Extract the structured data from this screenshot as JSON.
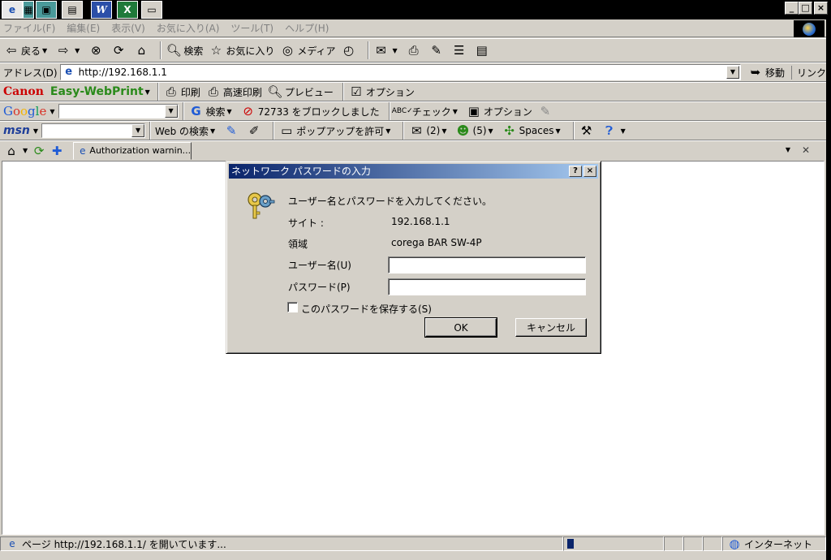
{
  "menu": [
    "ファイル(F)",
    "編集(E)",
    "表示(V)",
    "お気に入り(A)",
    "ツール(T)",
    "ヘルプ(H)"
  ],
  "toolbar": {
    "back": "戻る",
    "search": "検索",
    "favorites": "お気に入り",
    "media": "メディア"
  },
  "address": {
    "label": "アドレス(D)",
    "url": "http://192.168.1.1",
    "go": "移動",
    "links": "リンク"
  },
  "canon": {
    "logo": "Canon",
    "product": "Easy-WebPrint",
    "print": "印刷",
    "fast_print": "高速印刷",
    "preview": "プレビュー",
    "options": "オプション"
  },
  "google": {
    "search": "検索",
    "blocked": "72733 をブロックしました",
    "check": "チェック",
    "options": "オプション"
  },
  "msn": {
    "logo": "msn",
    "web_search": "Web の検索",
    "popup": "ポップアップを許可",
    "mail_count": "(2)",
    "messenger_count": "(5)",
    "spaces": "Spaces"
  },
  "tab": {
    "title": "Authorization warnin..."
  },
  "status": {
    "text": "ページ http://192.168.1.1/ を開いています...",
    "zone": "インターネット"
  },
  "dialog": {
    "title": "ネットワーク パスワードの入力",
    "prompt": "ユーザー名とパスワードを入力してください。",
    "site_label": "サイト :",
    "site_value": "192.168.1.1",
    "realm_label": "領域",
    "realm_value": "corega BAR SW-4P",
    "username_label": "ユーザー名(U)",
    "username_value": "",
    "password_label": "パスワード(P)",
    "password_value": "",
    "save_password": "このパスワードを保存する(S)",
    "ok": "OK",
    "cancel": "キャンセル"
  }
}
